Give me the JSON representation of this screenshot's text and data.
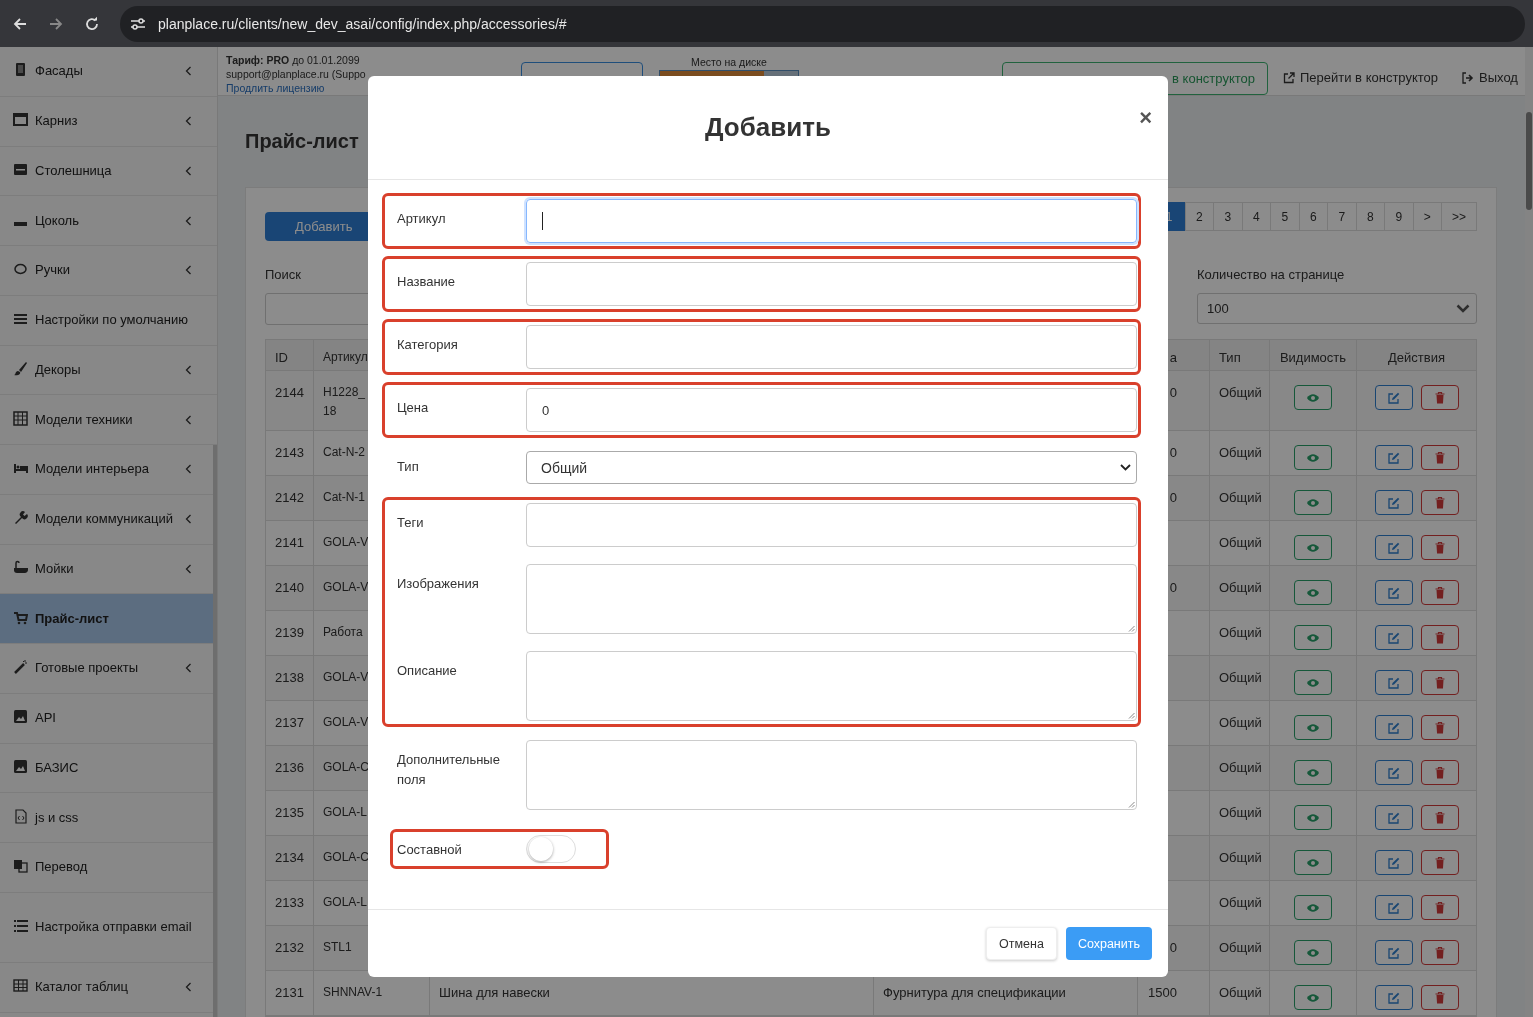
{
  "browser": {
    "url": "planplace.ru/clients/new_dev_asai/config/index.php/accessories/#"
  },
  "sidebar": {
    "items": [
      {
        "label": "Фасады",
        "expandable": true,
        "selected": false
      },
      {
        "label": "Карниз",
        "expandable": true,
        "selected": false
      },
      {
        "label": "Столешница",
        "expandable": true,
        "selected": false
      },
      {
        "label": "Цоколь",
        "expandable": true,
        "selected": false
      },
      {
        "label": "Ручки",
        "expandable": true,
        "selected": false
      },
      {
        "label": "Настройки по умолчанию",
        "expandable": false,
        "selected": false
      },
      {
        "label": "Декоры",
        "expandable": true,
        "selected": false
      },
      {
        "label": "Модели техники",
        "expandable": true,
        "selected": false
      },
      {
        "label": "Модели интерьера",
        "expandable": true,
        "selected": false
      },
      {
        "label": "Модели коммуникаций",
        "expandable": true,
        "selected": false
      },
      {
        "label": "Мойки",
        "expandable": true,
        "selected": false
      },
      {
        "label": "Прайс-лист",
        "expandable": false,
        "selected": true
      },
      {
        "label": "Готовые проекты",
        "expandable": true,
        "selected": false
      },
      {
        "label": "API",
        "expandable": false,
        "selected": false
      },
      {
        "label": "БАЗИС",
        "expandable": false,
        "selected": false
      },
      {
        "label": "js и css",
        "expandable": false,
        "selected": false
      },
      {
        "label": "Перевод",
        "expandable": false,
        "selected": false
      },
      {
        "label": "Настройка отправки email",
        "expandable": false,
        "selected": false
      },
      {
        "label": "Каталог таблиц",
        "expandable": true,
        "selected": false
      }
    ]
  },
  "header": {
    "tariff": "**Тариф: PRO** до 01.01.2099",
    "account": "support@planplace.ru (Suppo",
    "license_link": "Продлить лицензию",
    "disk": {
      "label": "Место на диске",
      "level": 0.75
    },
    "builder_button": "в конструктор",
    "links": [
      {
        "label": "Перейти в конструктор"
      },
      {
        "label": "Выход"
      }
    ]
  },
  "page": {
    "title": "Прайс-лист",
    "add_button": "Добавить",
    "search_label": "Поиск",
    "pagination": [
      {
        "label": "1",
        "selected": true
      },
      {
        "label": "2",
        "selected": false
      },
      {
        "label": "3",
        "selected": false
      },
      {
        "label": "4",
        "selected": false
      },
      {
        "label": "5",
        "selected": false
      },
      {
        "label": "6",
        "selected": false
      },
      {
        "label": "7",
        "selected": false
      },
      {
        "label": "8",
        "selected": false
      },
      {
        "label": "9",
        "selected": false
      },
      {
        "label": ">",
        "selected": false
      },
      {
        "label": ">>",
        "selected": false
      }
    ],
    "per_page": {
      "label": "Количество на странице",
      "value": "100"
    },
    "table": {
      "columns": [
        "ID",
        "Артикул",
        "а",
        "Тип",
        "Видимость",
        "Действия"
      ],
      "rows": [
        {
          "id": "2144",
          "article": "H1228_\n18",
          "price": "0",
          "type": "Общий",
          "visible": true
        },
        {
          "id": "2143",
          "article": "Cat-N-2",
          "price": "0",
          "type": "Общий",
          "visible": true
        },
        {
          "id": "2142",
          "article": "Cat-N-1",
          "price": "0",
          "type": "Общий",
          "visible": true
        },
        {
          "id": "2141",
          "article": "GOLA-V",
          "type": "Общий",
          "visible": true
        },
        {
          "id": "2140",
          "article": "GOLA-V",
          "price": "0",
          "type": "Общий",
          "visible": true
        },
        {
          "id": "2139",
          "article": "Работа",
          "type": "Общий",
          "visible": true
        },
        {
          "id": "2138",
          "article": "GOLA-V",
          "type": "Общий",
          "visible": true
        },
        {
          "id": "2137",
          "article": "GOLA-V",
          "type": "Общий",
          "visible": true
        },
        {
          "id": "2136",
          "article": "GOLA-C",
          "type": "Общий",
          "visible": true
        },
        {
          "id": "2135",
          "article": "GOLA-L",
          "type": "Общий",
          "visible": true
        },
        {
          "id": "2134",
          "article": "GOLA-C",
          "type": "Общий",
          "visible": true
        },
        {
          "id": "2133",
          "article": "GOLA-L",
          "type": "Общий",
          "visible": true
        },
        {
          "id": "2132",
          "article": "STL1",
          "price": "0",
          "type": "Общий",
          "visible": true
        },
        {
          "id": "2131",
          "article": "SHNNAV-1",
          "name": "Шина для навески",
          "category": "Фурнитура для спецификации",
          "price": "1500",
          "type": "Общий",
          "visible": true
        }
      ]
    }
  },
  "modal": {
    "title": "Добавить",
    "close": "×",
    "groups": [
      {
        "highlighted": true,
        "fields": [
          {
            "label": "Артикул",
            "kind": "input",
            "focused": true
          }
        ]
      },
      {
        "highlighted": true,
        "fields": [
          {
            "label": "Название",
            "kind": "input",
            "focused": false
          }
        ]
      },
      {
        "highlighted": true,
        "fields": [
          {
            "label": "Категория",
            "kind": "input",
            "focused": false
          }
        ]
      },
      {
        "highlighted": true,
        "fields": [
          {
            "label": "Цена",
            "kind": "input",
            "value": "0",
            "focused": false
          }
        ]
      },
      {
        "highlighted": false,
        "fields": [
          {
            "label": "Тип",
            "kind": "select",
            "value": "Общий"
          }
        ]
      },
      {
        "highlighted": true,
        "fields": [
          {
            "label": "Теги",
            "kind": "input",
            "focused": false
          },
          {
            "label": "Изображения",
            "kind": "textarea"
          },
          {
            "label": "Описание",
            "kind": "textarea"
          }
        ]
      },
      {
        "highlighted": false,
        "fields": [
          {
            "label": "Дополнительные поля",
            "kind": "textarea"
          }
        ]
      },
      {
        "highlighted": true,
        "fields": [
          {
            "label": "Составной",
            "kind": "toggle",
            "on": false
          }
        ]
      }
    ],
    "buttons": [
      {
        "label": "Отмена",
        "kind": "secondary"
      },
      {
        "label": "Сохранить",
        "kind": "primary"
      }
    ]
  }
}
